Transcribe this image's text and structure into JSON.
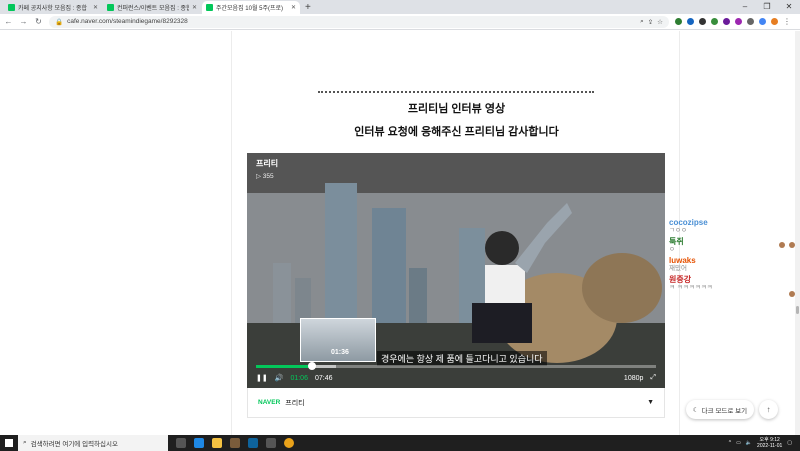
{
  "browser": {
    "tabs": [
      {
        "title": "카페 공지사항 모음집 : 종합",
        "active": false
      },
      {
        "title": "컨퍼런스/이벤트 모음집 : 종합 커뮤",
        "active": false
      },
      {
        "title": "주간모음집 10월 5주(프로)",
        "active": true
      }
    ],
    "new_tab": "+",
    "url": "cafe.naver.com/steamindiegame/8292328"
  },
  "article": {
    "heading1": "프리티님 인터뷰 영상",
    "heading2": "인터뷰 요청에 응해주신 프리티님 감사합니다"
  },
  "video": {
    "channel_title": "프리티",
    "views": "▷ 355",
    "hover_time": "01:36",
    "subtitle": "경우에는 항상 제 품에 들고다니고 있습니다",
    "current_time": "01:06",
    "duration": "07:46",
    "quality": "1080p",
    "progress_fraction": 0.14,
    "buffer_fraction": 0.2,
    "hover_fraction": 0.21
  },
  "video_footer": {
    "source": "NAVER",
    "channel": "프리티"
  },
  "chat": [
    {
      "nick": "cocozipse",
      "msg": "ㄱㅇㅇ",
      "color": "#4a8fd4"
    },
    {
      "nick": "툭쥐",
      "msg": "ㅇ",
      "color": "#2e7d32"
    },
    {
      "nick": "luwaks",
      "msg": "재밌어",
      "color": "#e65100"
    },
    {
      "nick": "원중강",
      "msg": "ㅋ ㅋㅋㅋㅋㅋㅋ",
      "color": "#c62828"
    }
  ],
  "floating": {
    "darkmode_label": "다크 모드로 보기",
    "top_label": "↑"
  },
  "taskbar": {
    "search_placeholder": "검색하려면 여기에 입력하십시오",
    "time": "오후 9:12",
    "date": "2022-11-01"
  },
  "colors": {
    "naver_green": "#03c75a",
    "chrome_tabbar": "#dee1e6",
    "taskbar": "#1f1f1f"
  }
}
